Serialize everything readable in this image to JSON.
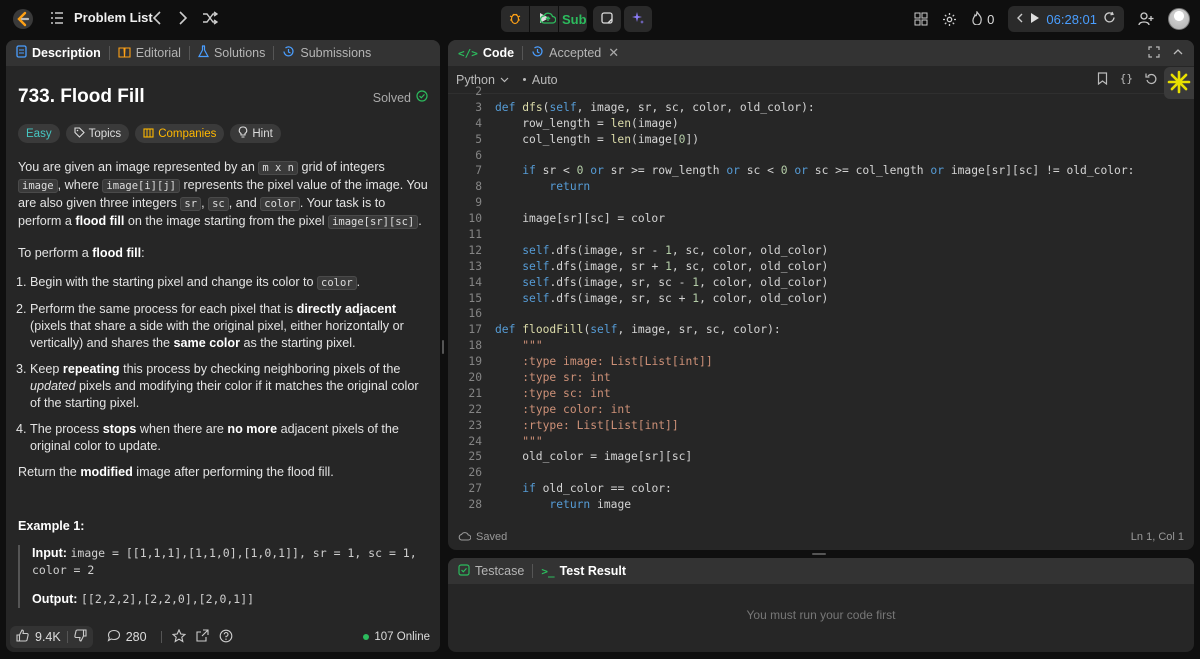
{
  "topbar": {
    "problem_list_label": "Problem List",
    "submit_label": "Submit",
    "streak_count": "0",
    "timer": "06:28:01"
  },
  "left": {
    "tabs": [
      {
        "label": "Description"
      },
      {
        "label": "Editorial"
      },
      {
        "label": "Solutions"
      },
      {
        "label": "Submissions"
      }
    ],
    "title": "733. Flood Fill",
    "solved_label": "Solved",
    "tags": [
      "Easy",
      "Topics",
      "Companies",
      "Hint"
    ],
    "para1": {
      "t1": "You are given an image represented by an ",
      "c1": "m x n",
      "t2": " grid of integers ",
      "c2": "image",
      "t3": ", where ",
      "c3": "image[i][j]",
      "t4": " represents the pixel value of the image. You are also given three integers ",
      "c4": "sr",
      "t5": ", ",
      "c5": "sc",
      "t6": ", and ",
      "c6": "color",
      "t7": ". Your task is to perform a ",
      "b1": "flood fill",
      "t8": " on the image starting from the pixel ",
      "c7": "image[sr][sc]",
      "t9": "."
    },
    "para2": {
      "t1": "To perform a ",
      "b1": "flood fill",
      "t2": ":"
    },
    "steps": {
      "s1": {
        "t1": "Begin with the starting pixel and change its color to ",
        "c1": "color",
        "t2": "."
      },
      "s2": {
        "t1": "Perform the same process for each pixel that is ",
        "b1": "directly adjacent",
        "t2": " (pixels that share a side with the original pixel, either horizontally or vertically) and shares the ",
        "b2": "same color",
        "t3": " as the starting pixel."
      },
      "s3": {
        "t1": "Keep ",
        "b1": "repeating",
        "t2": " this process by checking neighboring pixels of the ",
        "i1": "updated",
        "t3": " pixels and modifying their color if it matches the original color of the starting pixel."
      },
      "s4": {
        "t1": "The process ",
        "b1": "stops",
        "t2": " when there are ",
        "b2": "no more",
        "t3": " adjacent pixels of the original color to update."
      }
    },
    "para3": {
      "t1": "Return the ",
      "b1": "modified",
      "t2": " image after performing the flood fill."
    },
    "example_heading": "Example 1:",
    "example": {
      "input_label": "Input:",
      "input_value": "image = [[1,1,1],[1,1,0],[1,0,1]], sr = 1, sc = 1, color = 2",
      "output_label": "Output:",
      "output_value": "[[2,2,2],[2,2,0],[2,0,1]]"
    },
    "footer": {
      "likes": "9.4K",
      "comments": "280",
      "online": "107 Online"
    }
  },
  "code": {
    "tabs": [
      {
        "label": "Code"
      },
      {
        "label": "Accepted"
      }
    ],
    "language": "Python",
    "auto_label": "Auto",
    "status_saved": "Saved",
    "cursor_pos": "Ln 1, Col 1",
    "lines": [
      {
        "n": "2",
        "html": ""
      },
      {
        "n": "3",
        "html": "<span class=\"kw\">def</span> <span class=\"fn\">dfs</span>(<span class=\"self\">self</span>, image, sr, sc, color, old_color):"
      },
      {
        "n": "4",
        "html": "    row_length = <span class=\"fn\">len</span>(image)"
      },
      {
        "n": "5",
        "html": "    col_length = <span class=\"fn\">len</span>(image[<span class=\"num\">0</span>])"
      },
      {
        "n": "6",
        "html": ""
      },
      {
        "n": "7",
        "html": "    <span class=\"kw\">if</span> sr &lt; <span class=\"num\">0</span> <span class=\"kw\">or</span> sr &gt;= row_length <span class=\"kw\">or</span> sc &lt; <span class=\"num\">0</span> <span class=\"kw\">or</span> sc &gt;= col_length <span class=\"kw\">or</span> image[sr][sc] != old_color:"
      },
      {
        "n": "8",
        "html": "        <span class=\"kw\">return</span>"
      },
      {
        "n": "9",
        "html": ""
      },
      {
        "n": "10",
        "html": "    image[sr][sc] = color"
      },
      {
        "n": "11",
        "html": ""
      },
      {
        "n": "12",
        "html": "    <span class=\"self\">self</span>.dfs(image, sr - <span class=\"num\">1</span>, sc, color, old_color)"
      },
      {
        "n": "13",
        "html": "    <span class=\"self\">self</span>.dfs(image, sr + <span class=\"num\">1</span>, sc, color, old_color)"
      },
      {
        "n": "14",
        "html": "    <span class=\"self\">self</span>.dfs(image, sr, sc - <span class=\"num\">1</span>, color, old_color)"
      },
      {
        "n": "15",
        "html": "    <span class=\"self\">self</span>.dfs(image, sr, sc + <span class=\"num\">1</span>, color, old_color)"
      },
      {
        "n": "16",
        "html": ""
      },
      {
        "n": "17",
        "html": "<span class=\"kw\">def</span> <span class=\"fn\">floodFill</span>(<span class=\"self\">self</span>, image, sr, sc, color):"
      },
      {
        "n": "18",
        "html": "    <span class=\"str\">\"\"\"</span>"
      },
      {
        "n": "19",
        "html": "    <span class=\"str\">:type image: List[List[int]]</span>"
      },
      {
        "n": "20",
        "html": "    <span class=\"str\">:type sr: int</span>"
      },
      {
        "n": "21",
        "html": "    <span class=\"str\">:type sc: int</span>"
      },
      {
        "n": "22",
        "html": "    <span class=\"str\">:type color: int</span>"
      },
      {
        "n": "23",
        "html": "    <span class=\"str\">:rtype: List[List[int]]</span>"
      },
      {
        "n": "24",
        "html": "    <span class=\"str\">\"\"\"</span>"
      },
      {
        "n": "25",
        "html": "    old_color = image[sr][sc]"
      },
      {
        "n": "26",
        "html": ""
      },
      {
        "n": "27",
        "html": "    <span class=\"kw\">if</span> old_color == color:"
      },
      {
        "n": "28",
        "html": "        <span class=\"kw\">return</span> image"
      }
    ]
  },
  "test": {
    "tabs": [
      {
        "label": "Testcase"
      },
      {
        "label": "Test Result"
      }
    ],
    "message": "You must run your code first"
  },
  "colors": {
    "accent_green": "#2cbb5d",
    "easy": "#46c6c2",
    "timer_blue": "#4a9eff",
    "companies": "#ffb800"
  }
}
